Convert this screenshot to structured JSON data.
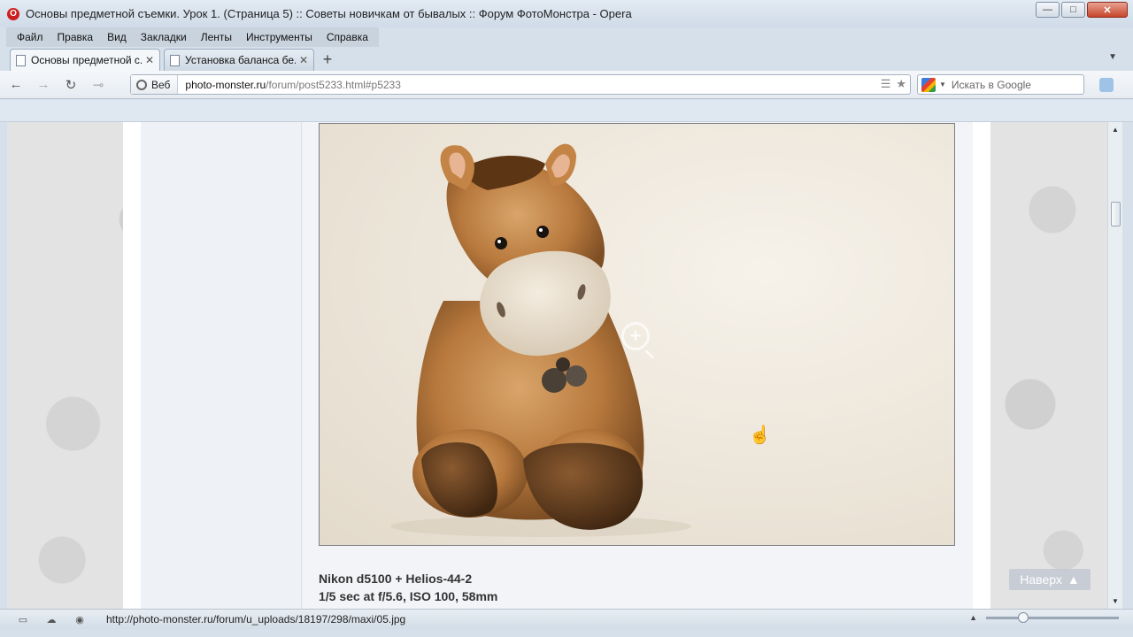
{
  "window": {
    "title": "Основы предметной съемки. Урок 1. (Страница 5) :: Советы новичкам от бывалых :: Форум ФотоМонстра - Opera",
    "minimize": "—",
    "maximize": "□",
    "close": "✕"
  },
  "menu": [
    "Файл",
    "Правка",
    "Вид",
    "Закладки",
    "Ленты",
    "Инструменты",
    "Справка"
  ],
  "tabs": [
    {
      "label": "Основы предметной с...",
      "close": "✕"
    },
    {
      "label": "Установка баланса бе...",
      "close": "✕"
    }
  ],
  "tab_new": "+",
  "tab_menu": "▼",
  "nav": {
    "back": "←",
    "forward": "→",
    "reload": "↻",
    "keys": "⊸"
  },
  "address": {
    "badge": "Веб",
    "host": "photo-monster.ru",
    "path": "/forum/post5233.html#p5233",
    "rss": "☰",
    "star": "★"
  },
  "search": {
    "placeholder": "Искать в Google",
    "dropdown": "▼"
  },
  "post": {
    "caption_line1": "Nikon d5100 + Helios-44-2",
    "caption_line2": "1/5 sec at f/5.6, ISO 100, 58mm",
    "zoom": "+"
  },
  "to_top": {
    "label": "Наверх",
    "arrow": "▲"
  },
  "scroll": {
    "up": "▲",
    "down": "▼"
  },
  "status": {
    "url": "http://photo-monster.ru/forum/u_uploads/18197/298/maxi/05.jpg",
    "up_arrow": "▲"
  }
}
